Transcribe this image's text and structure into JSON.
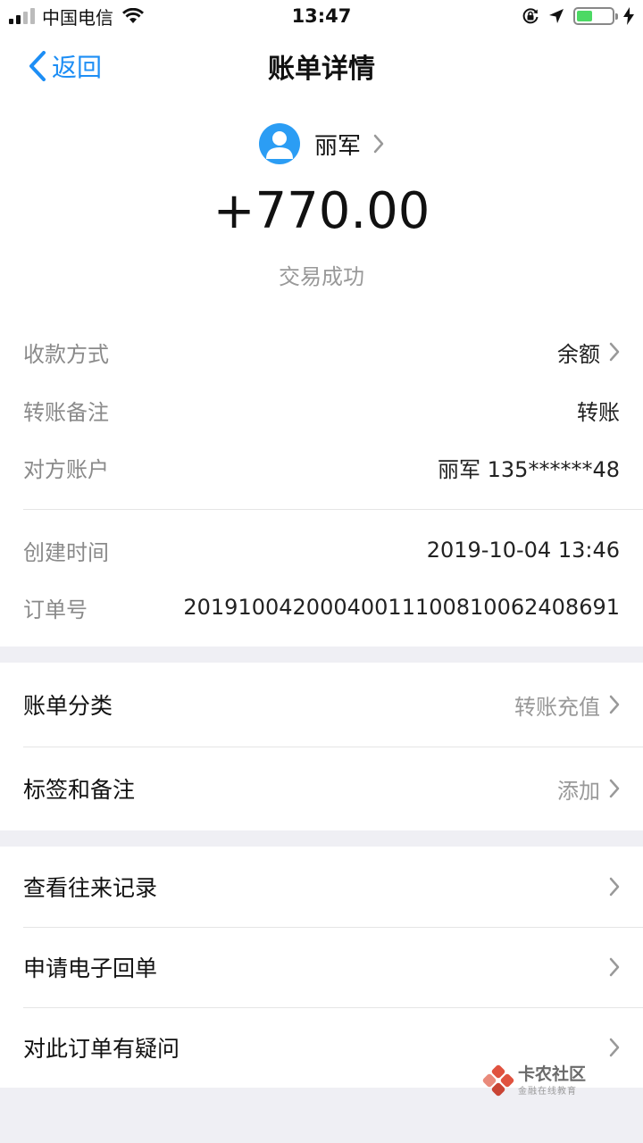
{
  "status_bar": {
    "carrier": "中国电信",
    "time": "13:47",
    "battery_level": 0.45,
    "icons": [
      "signal-icon",
      "wifi-icon",
      "orientation-lock-icon",
      "location-arrow-icon",
      "battery-icon",
      "charging-bolt-icon"
    ]
  },
  "nav": {
    "back_label": "返回",
    "title": "账单详情"
  },
  "header": {
    "payee_name": "丽军",
    "amount": "+770.00",
    "status": "交易成功"
  },
  "details": [
    {
      "label": "收款方式",
      "value": "余额",
      "chevron": true
    },
    {
      "label": "转账备注",
      "value": "转账",
      "chevron": false
    },
    {
      "label": "对方账户",
      "value": "丽军 135******48",
      "chevron": false
    },
    {
      "label": "创建时间",
      "value": "2019-10-04 13:46",
      "chevron": false
    },
    {
      "label": "订单号",
      "value": "20191004200040011100810062408691",
      "chevron": false
    }
  ],
  "group1": [
    {
      "label": "账单分类",
      "value": "转账充值"
    },
    {
      "label": "标签和备注",
      "value": "添加"
    }
  ],
  "group2": [
    {
      "label": "查看往来记录"
    },
    {
      "label": "申请电子回单"
    },
    {
      "label": "对此订单有疑问"
    }
  ],
  "watermark": {
    "title": "卡农社区",
    "subtitle": "金融在线教育"
  },
  "colors": {
    "accent": "#1d8ef5",
    "avatar": "#2b9df4",
    "battery": "#4cd964",
    "background": "#efeff4",
    "muted_text": "#999999",
    "watermark_logo": "#e0523f"
  }
}
